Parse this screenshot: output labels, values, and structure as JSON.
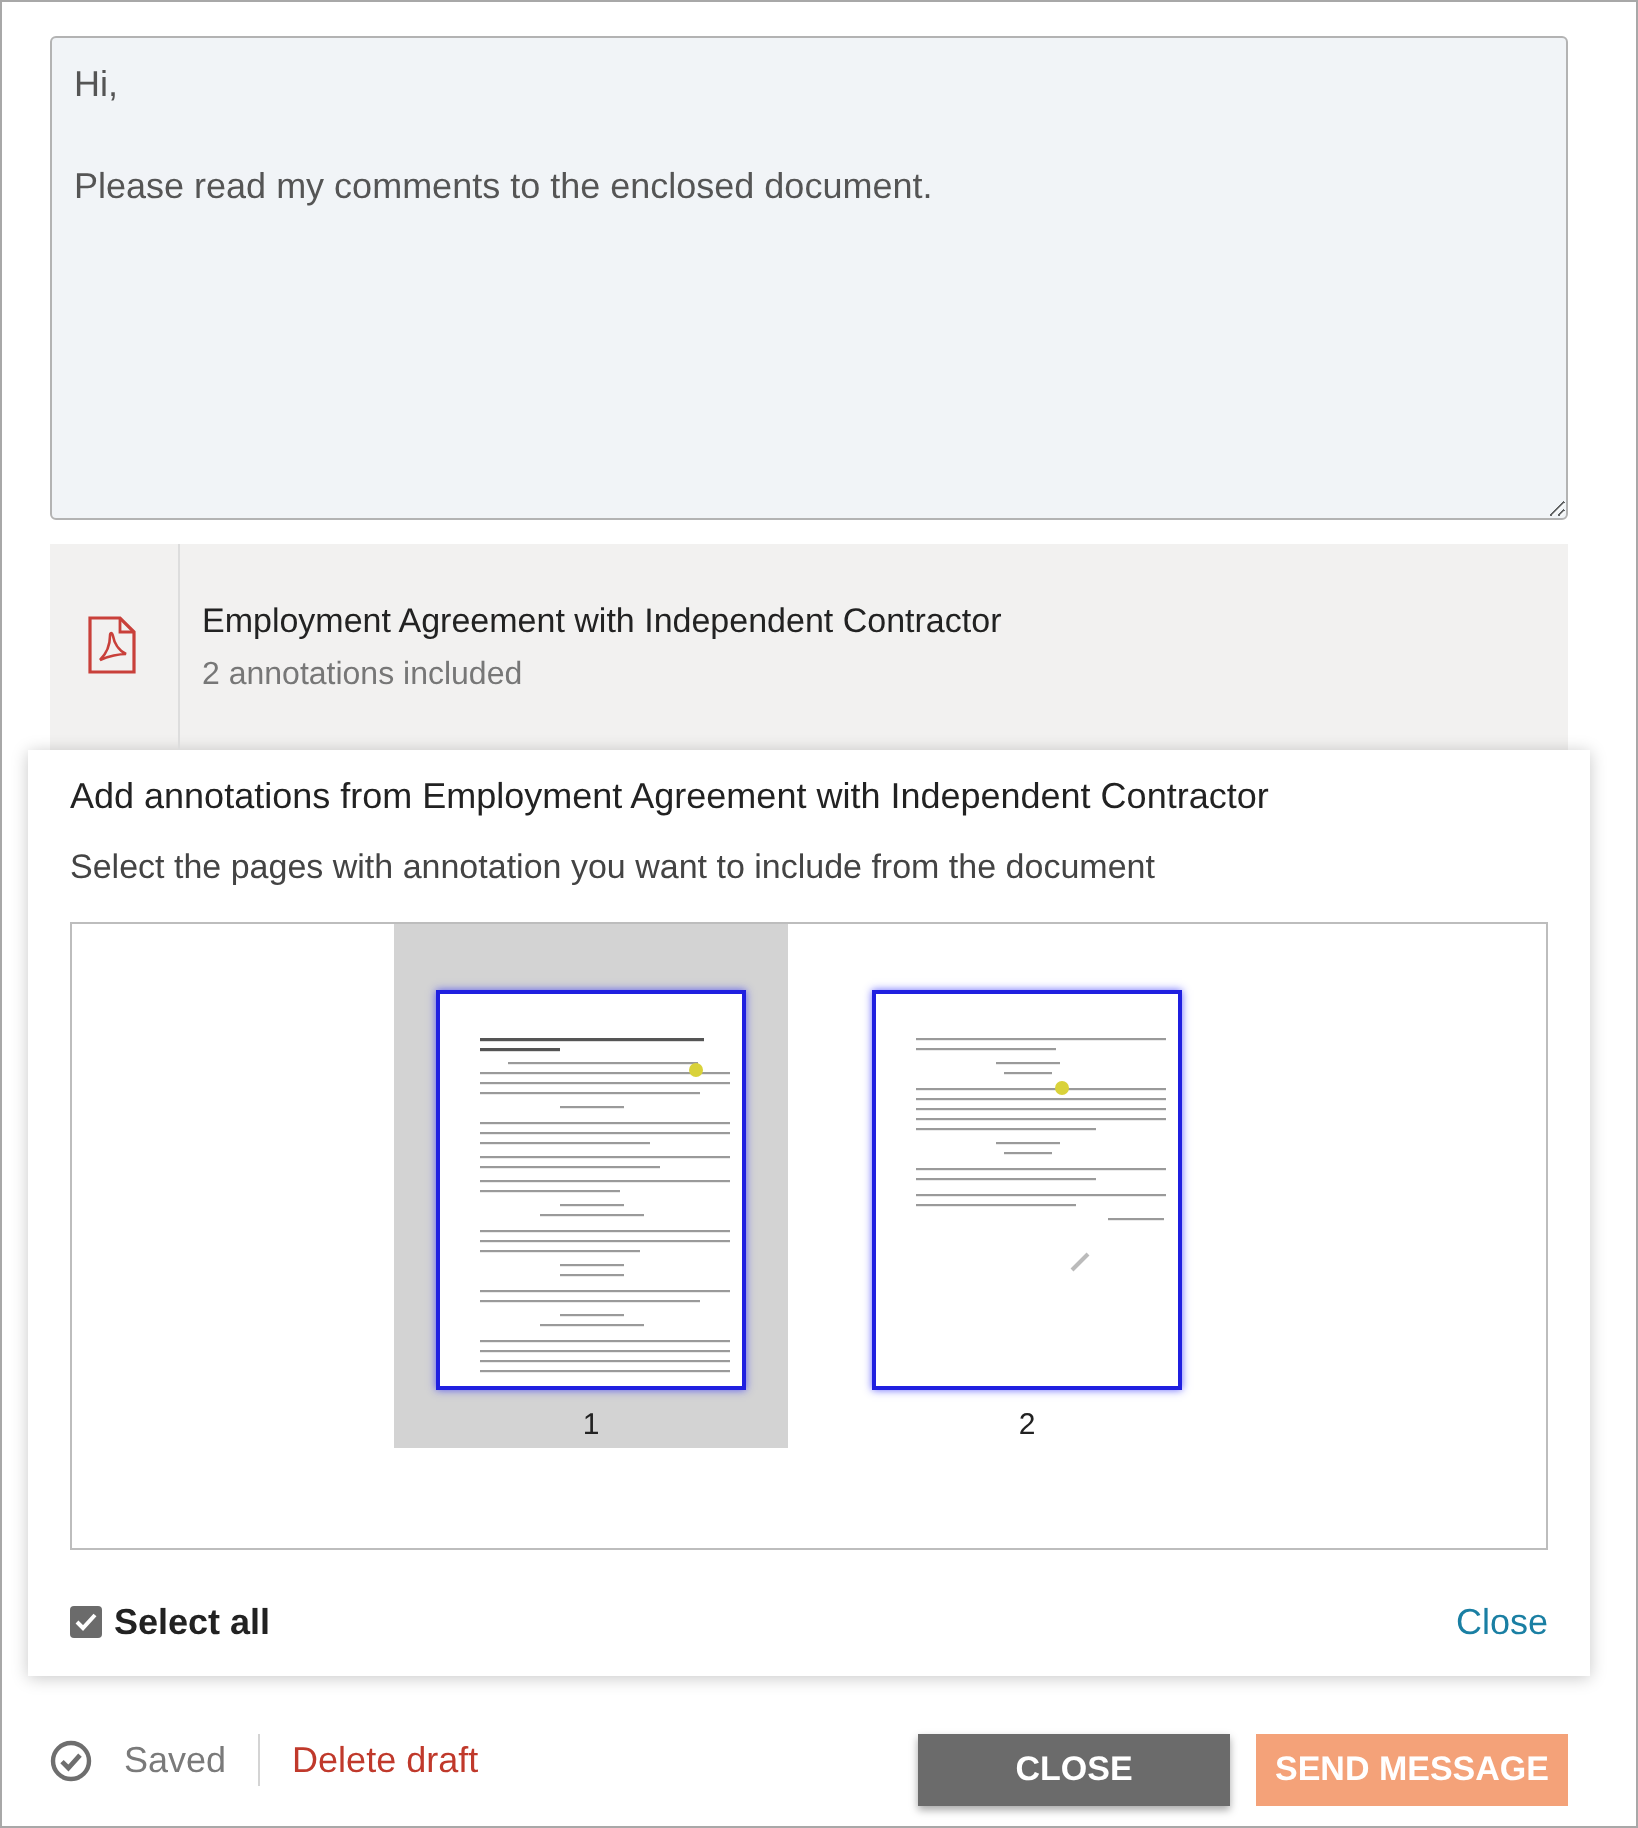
{
  "message": {
    "value": "Hi,\n\nPlease read my comments to the enclosed document."
  },
  "attachment": {
    "title": "Employment Agreement with Independent Contractor",
    "subtitle": "2 annotations included"
  },
  "annotation_panel": {
    "title": "Add annotations from Employment Agreement with Independent Contractor",
    "instructions": "Select the pages with annotation you want to include from the document",
    "pages": [
      {
        "label": "1",
        "selected": true
      },
      {
        "label": "2",
        "selected": false
      }
    ],
    "select_all": {
      "label": "Select all",
      "checked": true
    },
    "close_link": "Close"
  },
  "footer": {
    "status": "Saved",
    "delete_link": "Delete draft",
    "buttons": [
      {
        "label": "CLOSE",
        "kind": "secondary"
      },
      {
        "label": "SEND MESSAGE",
        "kind": "primary"
      }
    ]
  }
}
